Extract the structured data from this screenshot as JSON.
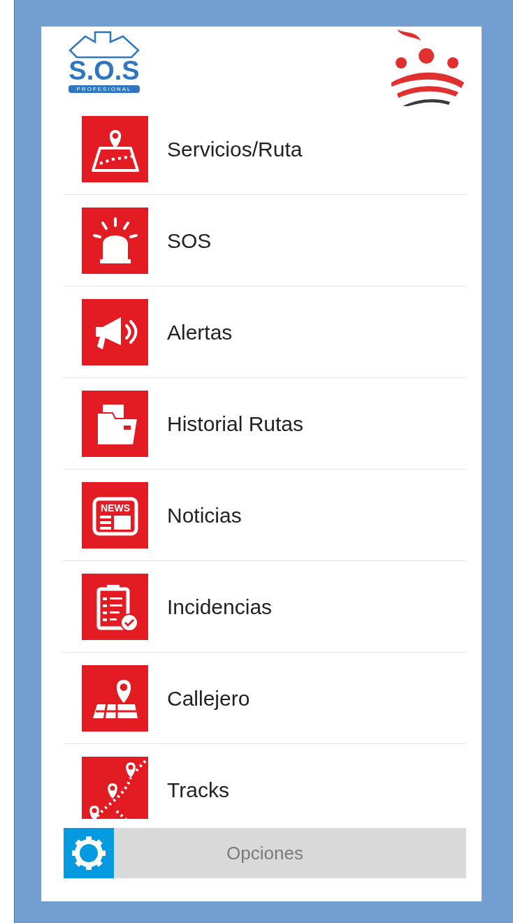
{
  "header": {
    "logo": {
      "title": "S.O.S",
      "subtitle": "PROFESIONAL"
    }
  },
  "menu": [
    {
      "label": "Servicios/Ruta",
      "kind": "route"
    },
    {
      "label": "SOS",
      "kind": "siren"
    },
    {
      "label": "Alertas",
      "kind": "megaphone"
    },
    {
      "label": "Historial Rutas",
      "kind": "folder"
    },
    {
      "label": "Noticias",
      "kind": "news",
      "icon_text": "NEWS"
    },
    {
      "label": "Incidencias",
      "kind": "clipboard"
    },
    {
      "label": "Callejero",
      "kind": "map"
    },
    {
      "label": "Tracks",
      "kind": "tracks"
    }
  ],
  "options_button": {
    "label": "Opciones"
  }
}
